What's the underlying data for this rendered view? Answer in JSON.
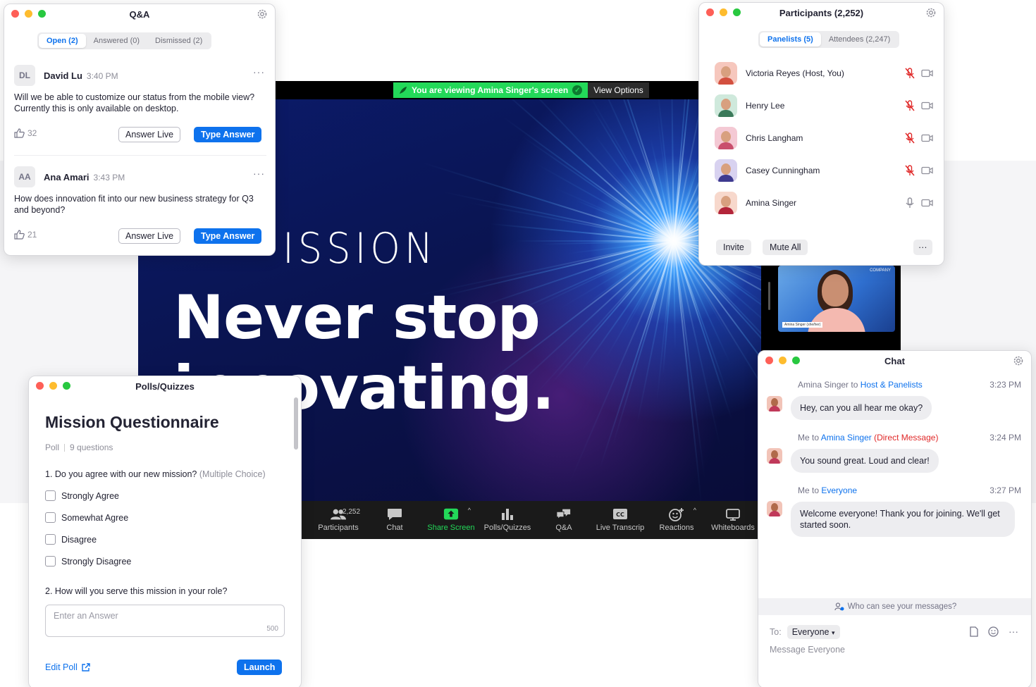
{
  "meeting": {
    "banner_text": "You are viewing Amina Singer's screen",
    "view_options_label": "View Options",
    "slide_mission": "ISSION",
    "slide_line1": "Never stop",
    "slide_line2": "innovating.",
    "self_video_badge": "COMPANY",
    "self_video_name": "Amina Singer (she/her)",
    "toolbar": {
      "participants_label": "Participants",
      "participants_count": "2,252",
      "chat_label": "Chat",
      "share_label": "Share Screen",
      "polls_label": "Polls/Quizzes",
      "qa_label": "Q&A",
      "transcript_label": "Live Transcrip",
      "reactions_label": "Reactions",
      "whiteboards_label": "Whiteboards"
    }
  },
  "qa": {
    "title": "Q&A",
    "tabs": [
      {
        "label": "Open (2)"
      },
      {
        "label": "Answered (0)"
      },
      {
        "label": "Dismissed (2)"
      }
    ],
    "questions": [
      {
        "initials": "DL",
        "name": "David Lu",
        "time": "3:40 PM",
        "text": "Will we be able to customize our status from the mobile view? Currently this is only available on desktop.",
        "likes": "32",
        "answer_live": "Answer Live",
        "type_answer": "Type Answer"
      },
      {
        "initials": "AA",
        "name": "Ana Amari",
        "time": "3:43 PM",
        "text": "How does innovation fit into our new business strategy for Q3 and beyond?",
        "likes": "21",
        "answer_live": "Answer Live",
        "type_answer": "Type Answer"
      }
    ]
  },
  "participants": {
    "title": "Participants (2,252)",
    "tabs": [
      {
        "label": "Panelists (5)"
      },
      {
        "label": "Attendees (2,247)"
      }
    ],
    "list": [
      {
        "name": "Victoria Reyes (Host, You)",
        "muted": true,
        "bg": "#f6c7bd",
        "shirt": "#d3503f"
      },
      {
        "name": "Henry Lee",
        "muted": true,
        "bg": "#cfe9dc",
        "shirt": "#3b7a5a"
      },
      {
        "name": "Chris Langham",
        "muted": true,
        "bg": "#f4c9d4",
        "shirt": "#c94f6d"
      },
      {
        "name": "Casey Cunningham",
        "muted": true,
        "bg": "#d8d2f0",
        "shirt": "#3e3a8f"
      },
      {
        "name": "Amina Singer",
        "muted": false,
        "bg": "#f7d8cc",
        "shirt": "#b3253a"
      }
    ],
    "invite_label": "Invite",
    "mute_all_label": "Mute All",
    "more_label": "···"
  },
  "polls": {
    "window_title": "Polls/Quizzes",
    "title": "Mission Questionnaire",
    "type": "Poll",
    "count": "9 questions",
    "q1": "1. Do you agree with our new mission?",
    "q1_hint": "(Multiple Choice)",
    "options": [
      {
        "label": "Strongly Agree"
      },
      {
        "label": "Somewhat Agree"
      },
      {
        "label": "Disagree"
      },
      {
        "label": "Strongly Disagree"
      }
    ],
    "q2": "2. How will you serve this mission in your role?",
    "answer_placeholder": "Enter an Answer",
    "char_limit": "500",
    "edit_label": "Edit Poll",
    "launch_label": "Launch"
  },
  "chat": {
    "title": "Chat",
    "messages": [
      {
        "from": "Amina Singer",
        "to_word": "to",
        "to": "Host & Panelists",
        "extra": "",
        "time": "3:23 PM",
        "text": "Hey, can you all hear me okay?"
      },
      {
        "from": "Me",
        "to_word": "to",
        "to": "Amina Singer",
        "extra": "(Direct Message)",
        "time": "3:24 PM",
        "text": "You sound great. Loud and clear!"
      },
      {
        "from": "Me",
        "to_word": "to",
        "to": "Everyone",
        "extra": "",
        "time": "3:27 PM",
        "text": "Welcome everyone! Thank you for joining. We'll get started soon."
      }
    ],
    "visibility_text": "Who can see your messages?",
    "to_label": "To:",
    "to_value": "Everyone",
    "placeholder": "Message Everyone"
  },
  "colors": {
    "accent": "#0e72ed",
    "share_green": "#23d959",
    "muted_red": "#e02828"
  }
}
